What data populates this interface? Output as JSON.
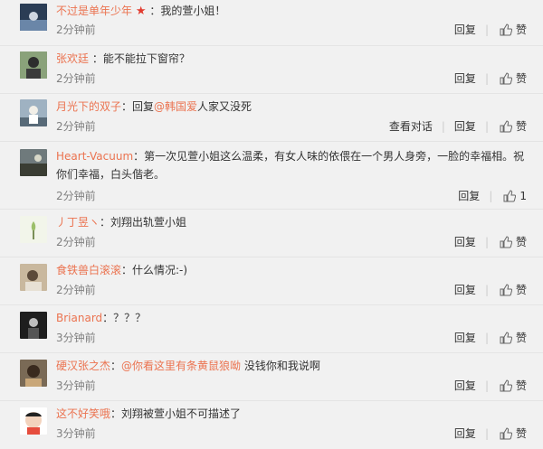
{
  "comments": [
    {
      "user": "不过是单年少年",
      "badge": "★",
      "text": "：我的萱小姐！",
      "time": "2分钟前",
      "reply": "回复",
      "like": "赞",
      "avatar_color": "#2b3d55"
    },
    {
      "user": "张欢廷",
      "text": "：能不能拉下窗帘？",
      "time": "2分钟前",
      "reply": "回复",
      "like": "赞",
      "avatar_color": "#556b4a"
    },
    {
      "user": "月光下的双子",
      "text_prefix": "：回复",
      "mention": "@韩国爱",
      "text": "人家又没死",
      "time": "2分钟前",
      "view": "查看对话",
      "reply": "回复",
      "like": "赞",
      "avatar_color": "#6e7f8e"
    },
    {
      "user": "Heart-Vacuum",
      "text": "：第一次见萱小姐这么温柔，有女人味的依偎在一个男人身旁，一脸的幸福相。祝你们幸福，白头偕老。",
      "time": "2分钟前",
      "reply": "回复",
      "like": "1",
      "avatar_color": "#4b4d44"
    },
    {
      "user": "丿丁昱ヽ",
      "text": "：刘翔出轨萱小姐",
      "time": "2分钟前",
      "reply": "回复",
      "like": "赞",
      "avatar_color": "#dfe8d2"
    },
    {
      "user": "食铁兽白滚滚",
      "text": "：什么情况:-)",
      "time": "2分钟前",
      "reply": "回复",
      "like": "赞",
      "avatar_color": "#9b8a74"
    },
    {
      "user": "Brianard",
      "text": "：？？？",
      "time": "3分钟前",
      "reply": "回复",
      "like": "赞",
      "avatar_color": "#2f2f2f"
    },
    {
      "user": "硬汉张之杰",
      "text_prefix": "：",
      "mention": "@你看这里有条黄鼠狼呦",
      "text": " 没钱你和我说啊",
      "time": "3分钟前",
      "reply": "回复",
      "like": "赞",
      "avatar_color": "#5a4a3a"
    },
    {
      "user": "这不好笑哦",
      "text": "：刘翔被萱小姐不可描述了",
      "time": "3分钟前",
      "reply": "回复",
      "like": "赞",
      "avatar_color": "#e0b8a8"
    }
  ]
}
